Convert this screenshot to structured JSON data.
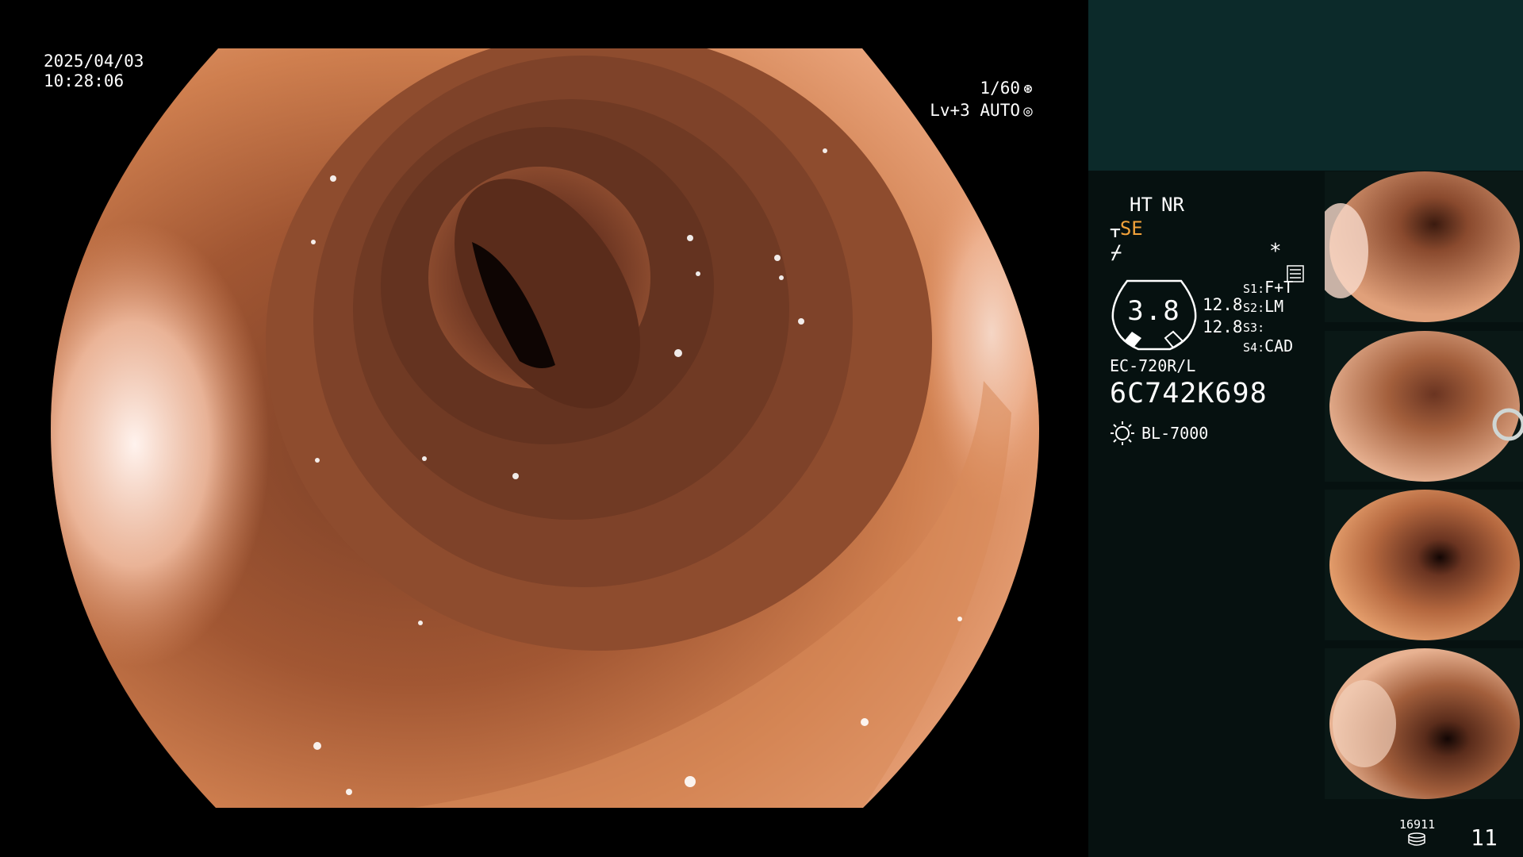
{
  "overlay": {
    "date": "2025/04/03",
    "time": "10:28:06",
    "shutter": "1/60",
    "exposure": "Lv+3 AUTO",
    "shutter_icon": "aperture-icon",
    "exposure_icon": "auto-exposure-icon"
  },
  "panel": {
    "ht": "HT",
    "nr": "NR",
    "se": "SE",
    "se_icon": "structure-enhance-icon",
    "freeze_icon": "freeze-icon",
    "menu_icon": "menu-icon",
    "star_icon": "*",
    "gauge": {
      "value": "3.8",
      "v1": "12.8",
      "v2": "12.8"
    },
    "switches": [
      {
        "key": "S1",
        "value": "F+T"
      },
      {
        "key": "S2",
        "value": "LM"
      },
      {
        "key": "S3",
        "value": ""
      },
      {
        "key": "S4",
        "value": "CAD"
      }
    ],
    "scope_model": "EC-720R/L",
    "serial": "6C742K698",
    "light_source": "BL-7000",
    "light_icon": "light-source-icon"
  },
  "footer": {
    "counter": "16911",
    "db_icon": "database-icon",
    "frame_count": "11"
  },
  "colors": {
    "accent_orange": "#f2a23a",
    "panel_header": "#0c2a2a",
    "panel_body": "#061110"
  }
}
